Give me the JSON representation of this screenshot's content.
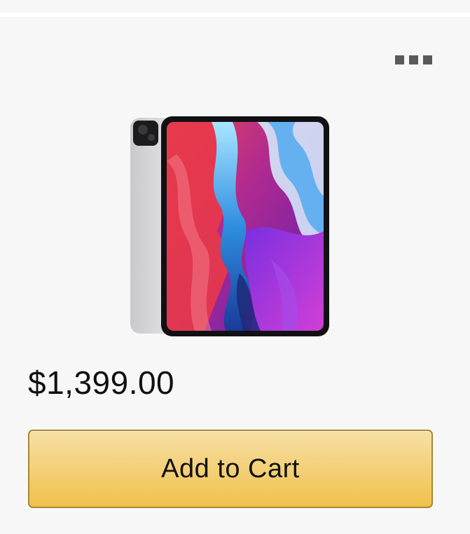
{
  "product": {
    "price": "$1,399.00",
    "image_icon": "tablet-product-image"
  },
  "actions": {
    "add_to_cart_label": "Add to Cart",
    "more_icon": "more-options-icon"
  },
  "colors": {
    "card_background": "#f7f7f7",
    "button_gradient_top": "#f7dfa5",
    "button_gradient_bottom": "#f0c14b",
    "button_border": "#a88734",
    "menu_dots": "#5a5a5a"
  }
}
